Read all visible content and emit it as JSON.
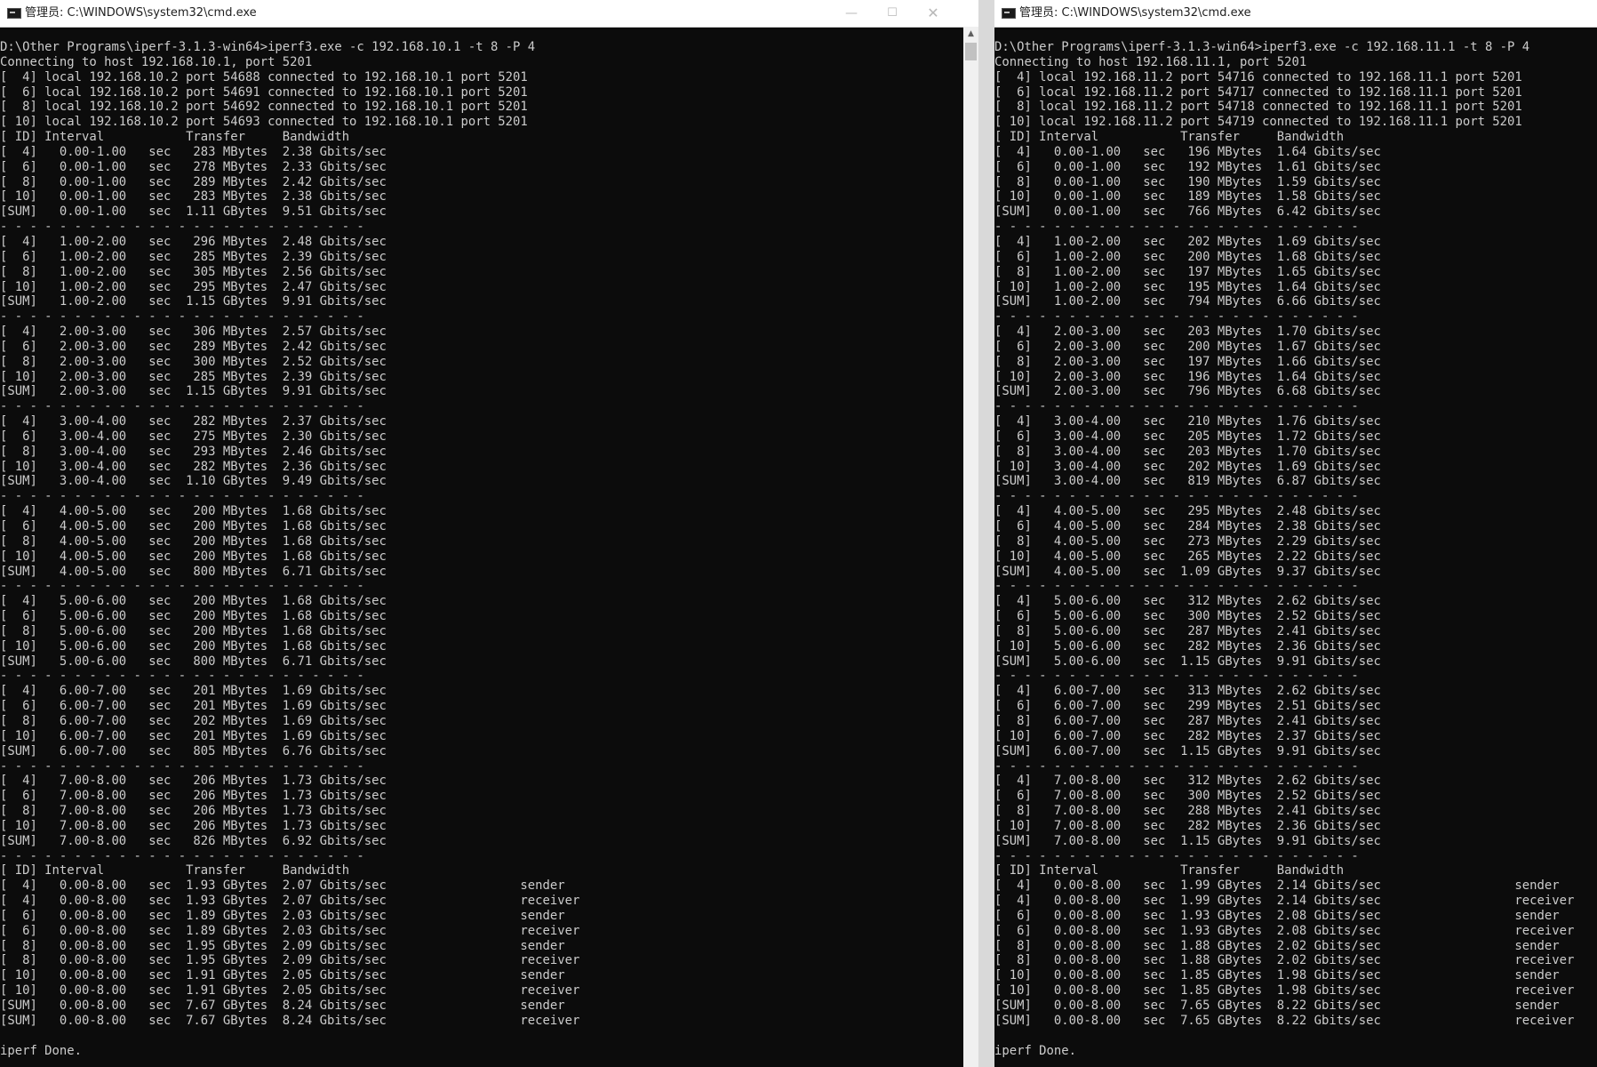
{
  "left_window": {
    "title": "管理员: C:\\WINDOWS\\system32\\cmd.exe",
    "controls": {
      "minimize": "—",
      "maximize": "☐",
      "close": "✕"
    },
    "lines": [
      "D:\\Other Programs\\iperf-3.1.3-win64>iperf3.exe -c 192.168.10.1 -t 8 -P 4",
      "Connecting to host 192.168.10.1, port 5201",
      "[  4] local 192.168.10.2 port 54688 connected to 192.168.10.1 port 5201",
      "[  6] local 192.168.10.2 port 54691 connected to 192.168.10.1 port 5201",
      "[  8] local 192.168.10.2 port 54692 connected to 192.168.10.1 port 5201",
      "[ 10] local 192.168.10.2 port 54693 connected to 192.168.10.1 port 5201",
      "[ ID] Interval           Transfer     Bandwidth",
      "[  4]   0.00-1.00   sec   283 MBytes  2.38 Gbits/sec",
      "[  6]   0.00-1.00   sec   278 MBytes  2.33 Gbits/sec",
      "[  8]   0.00-1.00   sec   289 MBytes  2.42 Gbits/sec",
      "[ 10]   0.00-1.00   sec   283 MBytes  2.38 Gbits/sec",
      "[SUM]   0.00-1.00   sec  1.11 GBytes  9.51 Gbits/sec",
      "- - - - - - - - - - - - - - - - - - - - - - - - -",
      "[  4]   1.00-2.00   sec   296 MBytes  2.48 Gbits/sec",
      "[  6]   1.00-2.00   sec   285 MBytes  2.39 Gbits/sec",
      "[  8]   1.00-2.00   sec   305 MBytes  2.56 Gbits/sec",
      "[ 10]   1.00-2.00   sec   295 MBytes  2.47 Gbits/sec",
      "[SUM]   1.00-2.00   sec  1.15 GBytes  9.91 Gbits/sec",
      "- - - - - - - - - - - - - - - - - - - - - - - - -",
      "[  4]   2.00-3.00   sec   306 MBytes  2.57 Gbits/sec",
      "[  6]   2.00-3.00   sec   289 MBytes  2.42 Gbits/sec",
      "[  8]   2.00-3.00   sec   300 MBytes  2.52 Gbits/sec",
      "[ 10]   2.00-3.00   sec   285 MBytes  2.39 Gbits/sec",
      "[SUM]   2.00-3.00   sec  1.15 GBytes  9.91 Gbits/sec",
      "- - - - - - - - - - - - - - - - - - - - - - - - -",
      "[  4]   3.00-4.00   sec   282 MBytes  2.37 Gbits/sec",
      "[  6]   3.00-4.00   sec   275 MBytes  2.30 Gbits/sec",
      "[  8]   3.00-4.00   sec   293 MBytes  2.46 Gbits/sec",
      "[ 10]   3.00-4.00   sec   282 MBytes  2.36 Gbits/sec",
      "[SUM]   3.00-4.00   sec  1.10 GBytes  9.49 Gbits/sec",
      "- - - - - - - - - - - - - - - - - - - - - - - - -",
      "[  4]   4.00-5.00   sec   200 MBytes  1.68 Gbits/sec",
      "[  6]   4.00-5.00   sec   200 MBytes  1.68 Gbits/sec",
      "[  8]   4.00-5.00   sec   200 MBytes  1.68 Gbits/sec",
      "[ 10]   4.00-5.00   sec   200 MBytes  1.68 Gbits/sec",
      "[SUM]   4.00-5.00   sec   800 MBytes  6.71 Gbits/sec",
      "- - - - - - - - - - - - - - - - - - - - - - - - -",
      "[  4]   5.00-6.00   sec   200 MBytes  1.68 Gbits/sec",
      "[  6]   5.00-6.00   sec   200 MBytes  1.68 Gbits/sec",
      "[  8]   5.00-6.00   sec   200 MBytes  1.68 Gbits/sec",
      "[ 10]   5.00-6.00   sec   200 MBytes  1.68 Gbits/sec",
      "[SUM]   5.00-6.00   sec   800 MBytes  6.71 Gbits/sec",
      "- - - - - - - - - - - - - - - - - - - - - - - - -",
      "[  4]   6.00-7.00   sec   201 MBytes  1.69 Gbits/sec",
      "[  6]   6.00-7.00   sec   201 MBytes  1.69 Gbits/sec",
      "[  8]   6.00-7.00   sec   202 MBytes  1.69 Gbits/sec",
      "[ 10]   6.00-7.00   sec   201 MBytes  1.69 Gbits/sec",
      "[SUM]   6.00-7.00   sec   805 MBytes  6.76 Gbits/sec",
      "- - - - - - - - - - - - - - - - - - - - - - - - -",
      "[  4]   7.00-8.00   sec   206 MBytes  1.73 Gbits/sec",
      "[  6]   7.00-8.00   sec   206 MBytes  1.73 Gbits/sec",
      "[  8]   7.00-8.00   sec   206 MBytes  1.73 Gbits/sec",
      "[ 10]   7.00-8.00   sec   206 MBytes  1.73 Gbits/sec",
      "[SUM]   7.00-8.00   sec   826 MBytes  6.92 Gbits/sec",
      "- - - - - - - - - - - - - - - - - - - - - - - - -",
      "[ ID] Interval           Transfer     Bandwidth",
      "[  4]   0.00-8.00   sec  1.93 GBytes  2.07 Gbits/sec                  sender",
      "[  4]   0.00-8.00   sec  1.93 GBytes  2.07 Gbits/sec                  receiver",
      "[  6]   0.00-8.00   sec  1.89 GBytes  2.03 Gbits/sec                  sender",
      "[  6]   0.00-8.00   sec  1.89 GBytes  2.03 Gbits/sec                  receiver",
      "[  8]   0.00-8.00   sec  1.95 GBytes  2.09 Gbits/sec                  sender",
      "[  8]   0.00-8.00   sec  1.95 GBytes  2.09 Gbits/sec                  receiver",
      "[ 10]   0.00-8.00   sec  1.91 GBytes  2.05 Gbits/sec                  sender",
      "[ 10]   0.00-8.00   sec  1.91 GBytes  2.05 Gbits/sec                  receiver",
      "[SUM]   0.00-8.00   sec  7.67 GBytes  8.24 Gbits/sec                  sender",
      "[SUM]   0.00-8.00   sec  7.67 GBytes  8.24 Gbits/sec                  receiver",
      "",
      "iperf Done."
    ]
  },
  "right_window": {
    "title": "管理员: C:\\WINDOWS\\system32\\cmd.exe",
    "lines": [
      "D:\\Other Programs\\iperf-3.1.3-win64>iperf3.exe -c 192.168.11.1 -t 8 -P 4",
      "Connecting to host 192.168.11.1, port 5201",
      "[  4] local 192.168.11.2 port 54716 connected to 192.168.11.1 port 5201",
      "[  6] local 192.168.11.2 port 54717 connected to 192.168.11.1 port 5201",
      "[  8] local 192.168.11.2 port 54718 connected to 192.168.11.1 port 5201",
      "[ 10] local 192.168.11.2 port 54719 connected to 192.168.11.1 port 5201",
      "[ ID] Interval           Transfer     Bandwidth",
      "[  4]   0.00-1.00   sec   196 MBytes  1.64 Gbits/sec",
      "[  6]   0.00-1.00   sec   192 MBytes  1.61 Gbits/sec",
      "[  8]   0.00-1.00   sec   190 MBytes  1.59 Gbits/sec",
      "[ 10]   0.00-1.00   sec   189 MBytes  1.58 Gbits/sec",
      "[SUM]   0.00-1.00   sec   766 MBytes  6.42 Gbits/sec",
      "- - - - - - - - - - - - - - - - - - - - - - - - -",
      "[  4]   1.00-2.00   sec   202 MBytes  1.69 Gbits/sec",
      "[  6]   1.00-2.00   sec   200 MBytes  1.68 Gbits/sec",
      "[  8]   1.00-2.00   sec   197 MBytes  1.65 Gbits/sec",
      "[ 10]   1.00-2.00   sec   195 MBytes  1.64 Gbits/sec",
      "[SUM]   1.00-2.00   sec   794 MBytes  6.66 Gbits/sec",
      "- - - - - - - - - - - - - - - - - - - - - - - - -",
      "[  4]   2.00-3.00   sec   203 MBytes  1.70 Gbits/sec",
      "[  6]   2.00-3.00   sec   200 MBytes  1.67 Gbits/sec",
      "[  8]   2.00-3.00   sec   197 MBytes  1.66 Gbits/sec",
      "[ 10]   2.00-3.00   sec   196 MBytes  1.64 Gbits/sec",
      "[SUM]   2.00-3.00   sec   796 MBytes  6.68 Gbits/sec",
      "- - - - - - - - - - - - - - - - - - - - - - - - -",
      "[  4]   3.00-4.00   sec   210 MBytes  1.76 Gbits/sec",
      "[  6]   3.00-4.00   sec   205 MBytes  1.72 Gbits/sec",
      "[  8]   3.00-4.00   sec   203 MBytes  1.70 Gbits/sec",
      "[ 10]   3.00-4.00   sec   202 MBytes  1.69 Gbits/sec",
      "[SUM]   3.00-4.00   sec   819 MBytes  6.87 Gbits/sec",
      "- - - - - - - - - - - - - - - - - - - - - - - - -",
      "[  4]   4.00-5.00   sec   295 MBytes  2.48 Gbits/sec",
      "[  6]   4.00-5.00   sec   284 MBytes  2.38 Gbits/sec",
      "[  8]   4.00-5.00   sec   273 MBytes  2.29 Gbits/sec",
      "[ 10]   4.00-5.00   sec   265 MBytes  2.22 Gbits/sec",
      "[SUM]   4.00-5.00   sec  1.09 GBytes  9.37 Gbits/sec",
      "- - - - - - - - - - - - - - - - - - - - - - - - -",
      "[  4]   5.00-6.00   sec   312 MBytes  2.62 Gbits/sec",
      "[  6]   5.00-6.00   sec   300 MBytes  2.52 Gbits/sec",
      "[  8]   5.00-6.00   sec   287 MBytes  2.41 Gbits/sec",
      "[ 10]   5.00-6.00   sec   282 MBytes  2.36 Gbits/sec",
      "[SUM]   5.00-6.00   sec  1.15 GBytes  9.91 Gbits/sec",
      "- - - - - - - - - - - - - - - - - - - - - - - - -",
      "[  4]   6.00-7.00   sec   313 MBytes  2.62 Gbits/sec",
      "[  6]   6.00-7.00   sec   299 MBytes  2.51 Gbits/sec",
      "[  8]   6.00-7.00   sec   287 MBytes  2.41 Gbits/sec",
      "[ 10]   6.00-7.00   sec   282 MBytes  2.37 Gbits/sec",
      "[SUM]   6.00-7.00   sec  1.15 GBytes  9.91 Gbits/sec",
      "- - - - - - - - - - - - - - - - - - - - - - - - -",
      "[  4]   7.00-8.00   sec   312 MBytes  2.62 Gbits/sec",
      "[  6]   7.00-8.00   sec   300 MBytes  2.52 Gbits/sec",
      "[  8]   7.00-8.00   sec   288 MBytes  2.41 Gbits/sec",
      "[ 10]   7.00-8.00   sec   282 MBytes  2.36 Gbits/sec",
      "[SUM]   7.00-8.00   sec  1.15 GBytes  9.91 Gbits/sec",
      "- - - - - - - - - - - - - - - - - - - - - - - - -",
      "[ ID] Interval           Transfer     Bandwidth",
      "[  4]   0.00-8.00   sec  1.99 GBytes  2.14 Gbits/sec                  sender",
      "[  4]   0.00-8.00   sec  1.99 GBytes  2.14 Gbits/sec                  receiver",
      "[  6]   0.00-8.00   sec  1.93 GBytes  2.08 Gbits/sec                  sender",
      "[  6]   0.00-8.00   sec  1.93 GBytes  2.08 Gbits/sec                  receiver",
      "[  8]   0.00-8.00   sec  1.88 GBytes  2.02 Gbits/sec                  sender",
      "[  8]   0.00-8.00   sec  1.88 GBytes  2.02 Gbits/sec                  receiver",
      "[ 10]   0.00-8.00   sec  1.85 GBytes  1.98 Gbits/sec                  sender",
      "[ 10]   0.00-8.00   sec  1.85 GBytes  1.98 Gbits/sec                  receiver",
      "[SUM]   0.00-8.00   sec  7.65 GBytes  8.22 Gbits/sec                  sender",
      "[SUM]   0.00-8.00   sec  7.65 GBytes  8.22 Gbits/sec                  receiver",
      "",
      "iperf Done."
    ]
  },
  "icons": {
    "app_icon": "cmd-icon",
    "scroll_up": "arrow-up-icon"
  },
  "colors": {
    "console_bg": "#0c0c0c",
    "console_text": "#cccccc",
    "titlebar_bg": "#ffffff"
  }
}
